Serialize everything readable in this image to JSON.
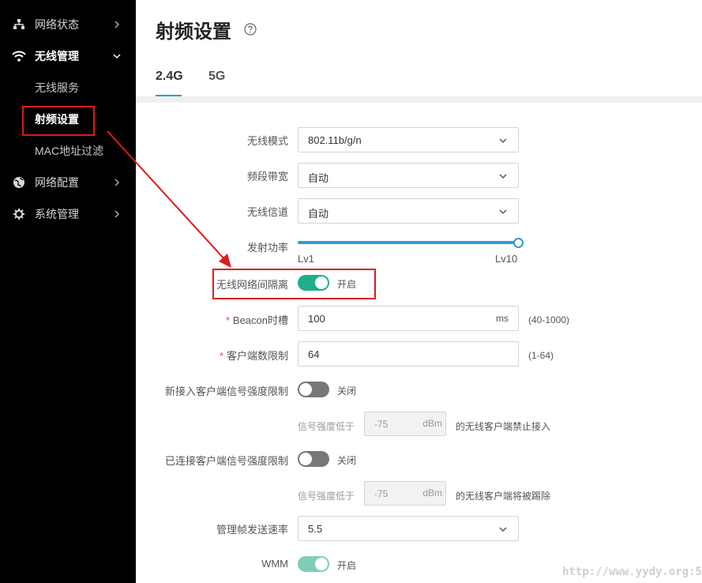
{
  "sidebar": {
    "items": [
      {
        "label": "网络状态",
        "icon": "network-icon"
      },
      {
        "label": "无线管理",
        "icon": "wifi-icon",
        "open": true,
        "children": [
          {
            "label": "无线服务"
          },
          {
            "label": "射频设置",
            "active": true
          },
          {
            "label": "MAC地址过滤"
          }
        ]
      },
      {
        "label": "网络配置",
        "icon": "globe-icon"
      },
      {
        "label": "系统管理",
        "icon": "gear-icon"
      }
    ]
  },
  "page": {
    "title": "射频设置",
    "tabs": [
      {
        "label": "2.4G",
        "active": true
      },
      {
        "label": "5G"
      }
    ]
  },
  "form": {
    "wireless_mode": {
      "label": "无线模式",
      "value": "802.11b/g/n"
    },
    "bandwidth": {
      "label": "频段带宽",
      "value": "自动"
    },
    "channel": {
      "label": "无线信道",
      "value": "自动"
    },
    "tx_power": {
      "label": "发射功率",
      "min_label": "Lv1",
      "max_label": "Lv10",
      "level": 10
    },
    "isolation": {
      "label": "无线网络间隔离",
      "state": "开启",
      "on": true
    },
    "beacon": {
      "label": "Beacon时槽",
      "value": "100",
      "unit": "ms",
      "hint": "(40-1000)",
      "required": "*"
    },
    "client_limit": {
      "label": "客户端数限制",
      "value": "64",
      "hint": "(1-64)",
      "required": "*"
    },
    "new_client_signal": {
      "label": "新接入客户端信号强度限制",
      "state": "关闭",
      "on": false,
      "sub_prefix": "信号强度低于",
      "sub_value": "-75",
      "sub_unit": "dBm",
      "sub_suffix": "的无线客户端禁止接入"
    },
    "connected_client_signal": {
      "label": "已连接客户端信号强度限制",
      "state": "关闭",
      "on": false,
      "sub_prefix": "信号强度低于",
      "sub_value": "-75",
      "sub_unit": "dBm",
      "sub_suffix": "的无线客户端将被踢除"
    },
    "mgmt_rate": {
      "label": "管理帧发送速率",
      "value": "5.5"
    },
    "wmm": {
      "label": "WMM",
      "state": "开启",
      "on": true
    }
  },
  "watermark": "http://www.yydy.org:5",
  "colors": {
    "accent": "#2e9bd6",
    "toggle_on": "#1fae8a",
    "annotation": "#e0191b",
    "sidebar_bg": "#000000"
  }
}
